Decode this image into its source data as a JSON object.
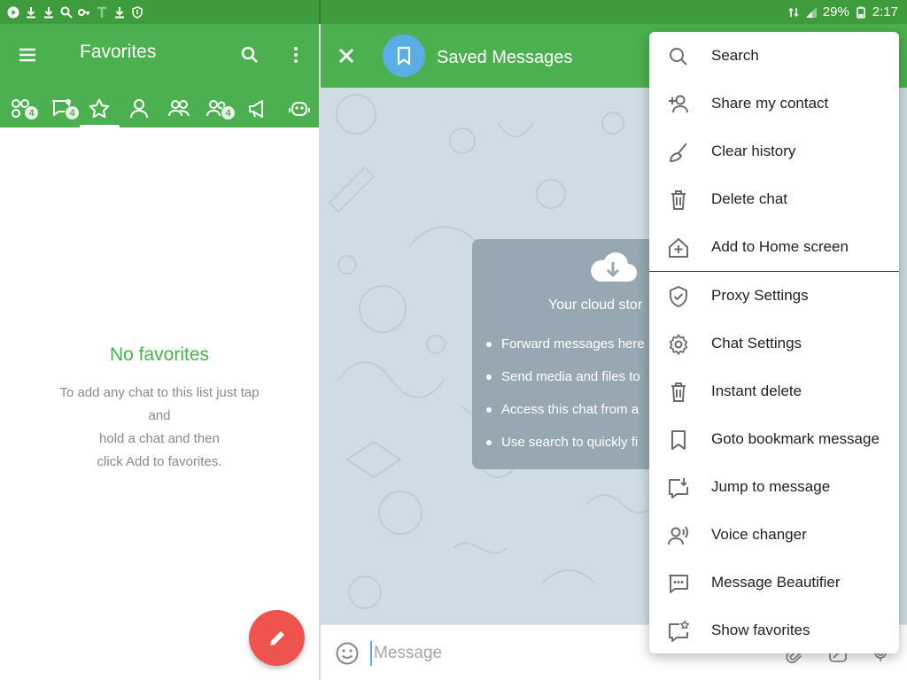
{
  "status_bar": {
    "battery": "29%",
    "time": "2:17"
  },
  "left": {
    "title": "Favorites",
    "tabs": [
      {
        "icon": "all-chats-icon",
        "badge": "4"
      },
      {
        "icon": "unread-chats-icon",
        "badge": "4"
      },
      {
        "icon": "star-icon",
        "badge": ""
      },
      {
        "icon": "user-icon",
        "badge": ""
      },
      {
        "icon": "groups-icon",
        "badge": ""
      },
      {
        "icon": "supergroups-icon",
        "badge": "4"
      },
      {
        "icon": "channels-icon",
        "badge": ""
      },
      {
        "icon": "bots-icon",
        "badge": ""
      }
    ],
    "empty_title": "No favorites",
    "empty_lines": [
      "To add any chat to this list just tap",
      "and",
      "hold a chat and then",
      "click Add to favorites."
    ]
  },
  "chat": {
    "title": "Saved Messages",
    "card_title": "Your cloud stor",
    "card_items": [
      "Forward messages here",
      "Send media and files to",
      "Access this chat from a",
      "Use search to quickly fi"
    ],
    "message_placeholder": "Message"
  },
  "menu": {
    "items_top": [
      {
        "label": "Search",
        "icon": "search-icon"
      },
      {
        "label": "Share my contact",
        "icon": "add-contact-icon"
      },
      {
        "label": "Clear history",
        "icon": "broom-icon"
      },
      {
        "label": "Delete chat",
        "icon": "trash-icon"
      },
      {
        "label": "Add to Home screen",
        "icon": "home-add-icon"
      }
    ],
    "items_bottom": [
      {
        "label": "Proxy Settings",
        "icon": "shield-check-icon"
      },
      {
        "label": "Chat Settings",
        "icon": "gear-icon"
      },
      {
        "label": "Instant delete",
        "icon": "trash-icon"
      },
      {
        "label": "Goto bookmark message",
        "icon": "bookmark-icon"
      },
      {
        "label": "Jump to message",
        "icon": "jump-icon"
      },
      {
        "label": "Voice changer",
        "icon": "voice-icon"
      },
      {
        "label": "Message Beautifier",
        "icon": "message-dots-icon"
      },
      {
        "label": "Show favorites",
        "icon": "star-message-icon"
      }
    ]
  },
  "colors": {
    "primary": "#4caf50",
    "status": "#3e9c3d",
    "fab": "#ef5350",
    "avatar": "#5aaee3",
    "chat_bg": "#cfdce3"
  }
}
